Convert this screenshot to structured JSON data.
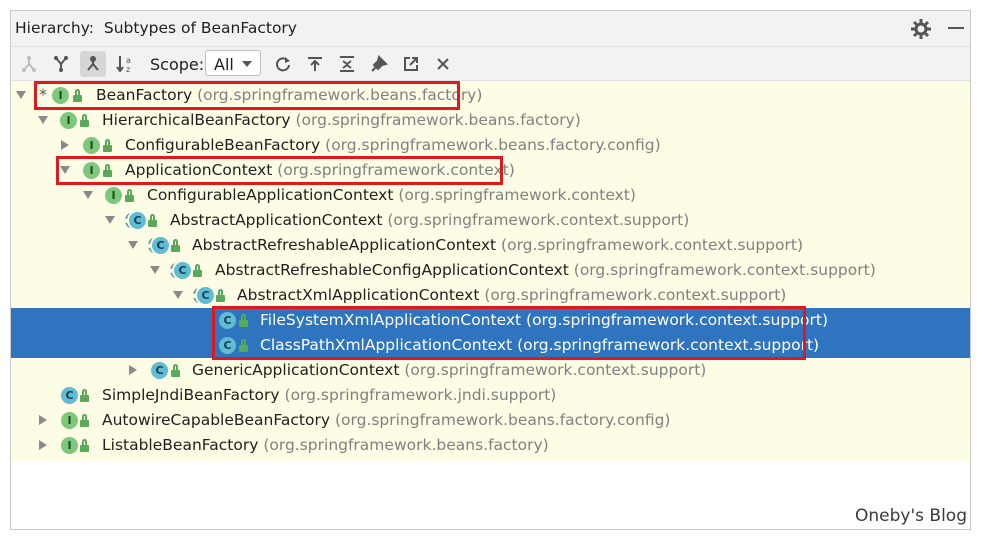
{
  "title": {
    "label": "Hierarchy:",
    "target": "Subtypes of BeanFactory"
  },
  "toolbar": {
    "scope_label": "Scope:",
    "scope_value": "All"
  },
  "tree": [
    {
      "name": "BeanFactory",
      "pkg": "(org.springframework.beans.factory)",
      "kind": "interface",
      "star": "*"
    },
    {
      "name": "HierarchicalBeanFactory",
      "pkg": "(org.springframework.beans.factory)",
      "kind": "interface"
    },
    {
      "name": "ConfigurableBeanFactory",
      "pkg": "(org.springframework.beans.factory.config)",
      "kind": "interface"
    },
    {
      "name": "ApplicationContext",
      "pkg": "(org.springframework.context)",
      "kind": "interface"
    },
    {
      "name": "ConfigurableApplicationContext",
      "pkg": "(org.springframework.context)",
      "kind": "interface"
    },
    {
      "name": "AbstractApplicationContext",
      "pkg": "(org.springframework.context.support)",
      "kind": "abstract"
    },
    {
      "name": "AbstractRefreshableApplicationContext",
      "pkg": "(org.springframework.context.support)",
      "kind": "abstract"
    },
    {
      "name": "AbstractRefreshableConfigApplicationContext",
      "pkg": "(org.springframework.context.support)",
      "kind": "abstract"
    },
    {
      "name": "AbstractXmlApplicationContext",
      "pkg": "(org.springframework.context.support)",
      "kind": "abstract"
    },
    {
      "name": "FileSystemXmlApplicationContext",
      "pkg": "(org.springframework.context.support)",
      "kind": "class"
    },
    {
      "name": "ClassPathXmlApplicationContext",
      "pkg": "(org.springframework.context.support)",
      "kind": "class"
    },
    {
      "name": "GenericApplicationContext",
      "pkg": "(org.springframework.context.support)",
      "kind": "class"
    },
    {
      "name": "SimpleJndiBeanFactory",
      "pkg": "(org.springframework.jndi.support)",
      "kind": "class"
    },
    {
      "name": "AutowireCapableBeanFactory",
      "pkg": "(org.springframework.beans.factory.config)",
      "kind": "interface"
    },
    {
      "name": "ListableBeanFactory",
      "pkg": "(org.springframework.beans.factory)",
      "kind": "interface"
    }
  ],
  "icons": {
    "interface_letter": "I",
    "class_letter": "C"
  },
  "watermark": "Oneby's Blog",
  "colors": {
    "selection": "#2e74be",
    "tree_bg": "#fdfde6",
    "highlight_box": "#e0191f"
  }
}
